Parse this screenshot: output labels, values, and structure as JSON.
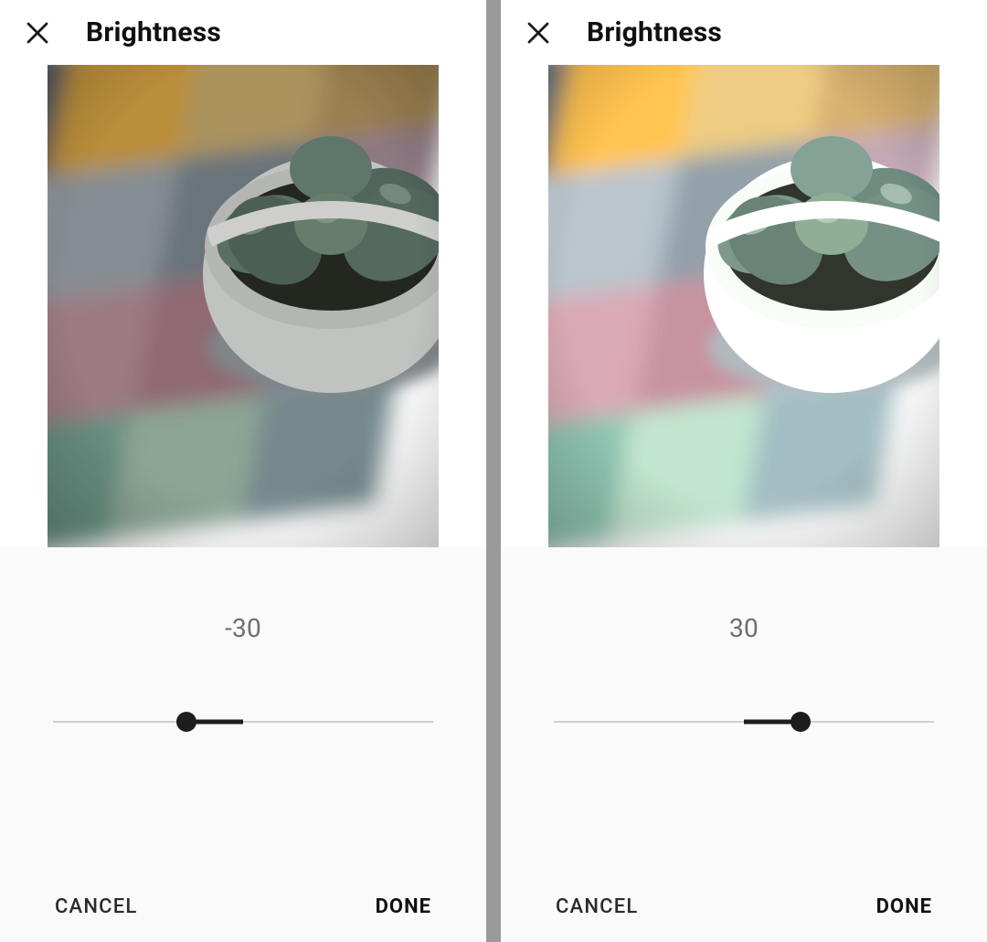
{
  "panels": [
    {
      "title": "Brightness",
      "value": "-30",
      "slider": {
        "min": -100,
        "max": 100,
        "center": 50,
        "value": -30,
        "handle_pct": 35
      },
      "cancel_label": "CANCEL",
      "done_label": "DONE",
      "brightness_filter": 0.85
    },
    {
      "title": "Brightness",
      "value": "30",
      "slider": {
        "min": -100,
        "max": 100,
        "center": 50,
        "value": 30,
        "handle_pct": 65
      },
      "cancel_label": "CANCEL",
      "done_label": "DONE",
      "brightness_filter": 1.15
    }
  ],
  "icons": {
    "close": "close-icon"
  }
}
